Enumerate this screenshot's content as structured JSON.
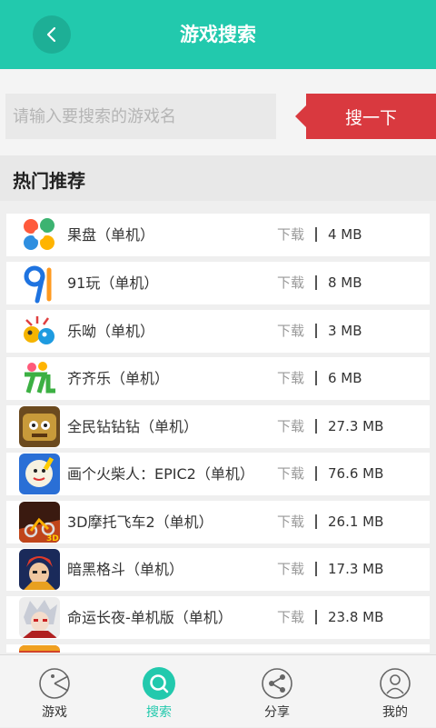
{
  "header": {
    "title": "游戏搜索",
    "back_icon": "back-arrow-icon"
  },
  "search": {
    "placeholder": "请输入要搜索的游戏名",
    "value": "",
    "button_label": "搜一下"
  },
  "section": {
    "title": "热门推荐"
  },
  "games": [
    {
      "name": "果盘（单机）",
      "download_label": "下载",
      "size": "4 MB",
      "icon": "guopan-icon"
    },
    {
      "name": "91玩（单机）",
      "download_label": "下载",
      "size": "8 MB",
      "icon": "91wan-icon"
    },
    {
      "name": "乐呦（单机）",
      "download_label": "下载",
      "size": "3 MB",
      "icon": "leyou-icon"
    },
    {
      "name": "齐齐乐（单机）",
      "download_label": "下载",
      "size": "6 MB",
      "icon": "qiqile-icon"
    },
    {
      "name": "全民钻钻钻（单机）",
      "download_label": "下载",
      "size": "27.3 MB",
      "icon": "quanmin-zuan-icon"
    },
    {
      "name": "画个火柴人：EPIC2（单机）",
      "download_label": "下载",
      "size": "76.6 MB",
      "icon": "draw-stickman-icon"
    },
    {
      "name": "3D摩托飞车2（单机）",
      "download_label": "下载",
      "size": "26.1 MB",
      "icon": "moto-racing-icon"
    },
    {
      "name": "暗黑格斗（单机）",
      "download_label": "下载",
      "size": "17.3 MB",
      "icon": "dark-fight-icon"
    },
    {
      "name": "命运长夜-单机版（单机）",
      "download_label": "下载",
      "size": "23.8 MB",
      "icon": "fate-night-icon"
    }
  ],
  "tabs": [
    {
      "label": "游戏",
      "icon": "pacman-icon",
      "active": false
    },
    {
      "label": "搜索",
      "icon": "search-icon",
      "active": true
    },
    {
      "label": "分享",
      "icon": "share-icon",
      "active": false
    },
    {
      "label": "我的",
      "icon": "user-icon",
      "active": false
    }
  ],
  "colors": {
    "primary": "#22c9ad",
    "search_button": "#d9393f",
    "background": "#efefef"
  }
}
